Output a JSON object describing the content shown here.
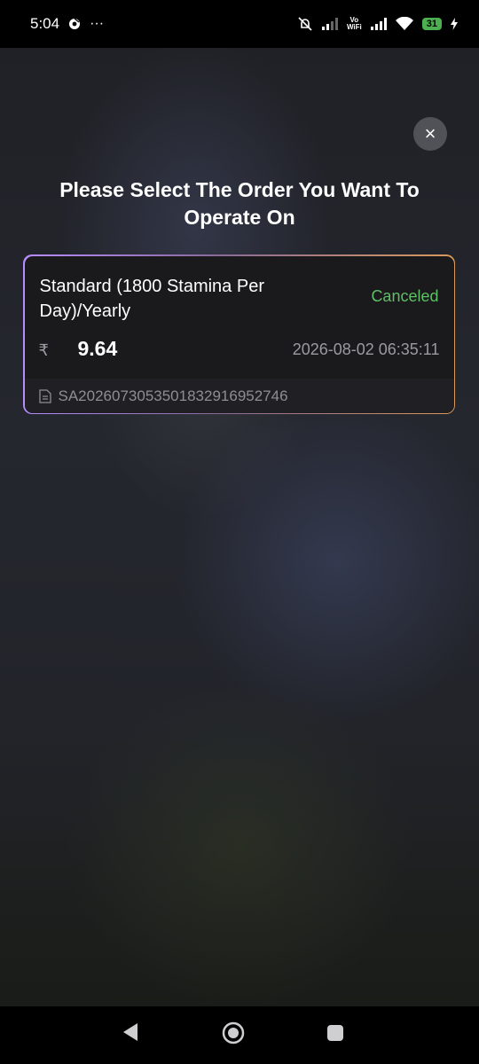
{
  "status_bar": {
    "time": "5:04",
    "more": "···",
    "vowifi": "Vo\nWiFi",
    "battery": "31"
  },
  "dialog": {
    "title": "Please Select The Order You Want To Operate On",
    "close_label": "×"
  },
  "order": {
    "plan": "Standard (1800 Stamina Per Day)/Yearly",
    "status": "Canceled",
    "currency_symbol": "₹",
    "amount": "9.64",
    "datetime": "2026-08-02 06:35:11",
    "order_id": "SA20260730535018329169527​46"
  },
  "colors": {
    "status_green": "#5fbf64",
    "card_border_start": "#b68cff",
    "card_border_end": "#d99a5a"
  },
  "icons": {
    "status_bar": [
      "chrome-icon",
      "mute-icon",
      "signal-icon",
      "wifi-icon",
      "charging-icon"
    ],
    "nav_bar": [
      "back-icon",
      "home-icon",
      "recents-icon"
    ],
    "order": "document-icon"
  }
}
